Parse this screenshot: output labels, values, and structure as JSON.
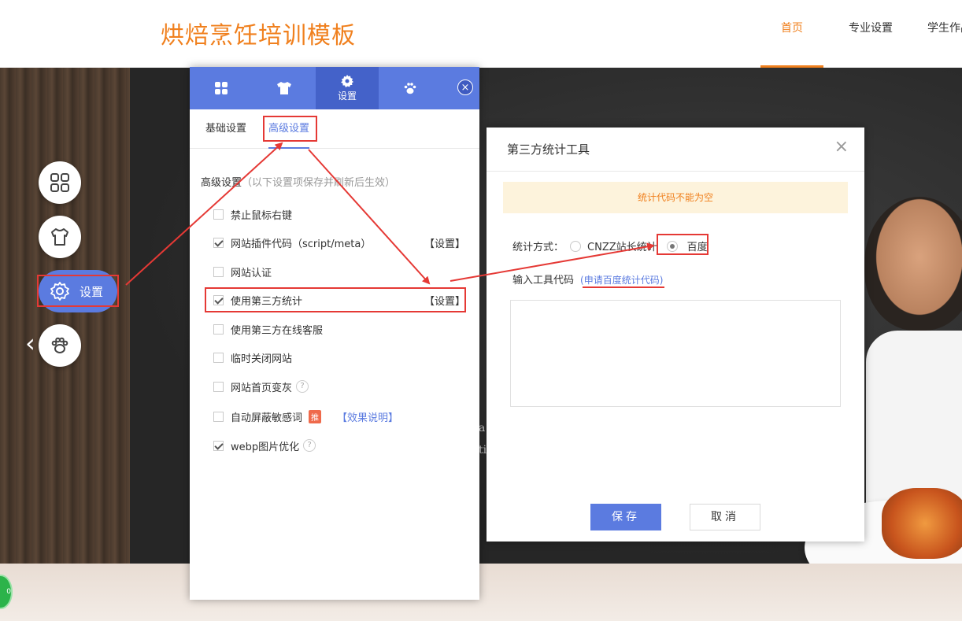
{
  "header": {
    "site_title": "烘焙烹饪培训模板",
    "nav": [
      "首页",
      "专业设置",
      "学生作品"
    ]
  },
  "float_tools": {
    "settings_label": "设置"
  },
  "panel": {
    "tabs": [
      {
        "icon": "grid-icon",
        "label": ""
      },
      {
        "icon": "tshirt-icon",
        "label": ""
      },
      {
        "icon": "gear-icon",
        "label": "设置"
      },
      {
        "icon": "paw-icon",
        "label": ""
      }
    ],
    "close": "×",
    "sub_tabs": [
      "基础设置",
      "高级设置"
    ],
    "section_title": "高级设置",
    "section_hint": "（以下设置项保存并刷新后生效）",
    "options": [
      {
        "label": "禁止鼠标右键",
        "checked": false
      },
      {
        "label": "网站插件代码（script/meta）",
        "checked": true,
        "action": "【设置】"
      },
      {
        "label": "网站认证",
        "checked": false
      },
      {
        "label": "使用第三方统计",
        "checked": true,
        "action": "【设置】"
      },
      {
        "label": "使用第三方在线客服",
        "checked": false
      },
      {
        "label": "临时关闭网站",
        "checked": false
      },
      {
        "label": "网站首页变灰",
        "checked": false,
        "help": "?"
      },
      {
        "label": "自动屏蔽敏感词",
        "checked": false,
        "badge": "推",
        "link": "【效果说明】"
      },
      {
        "label": "webp图片优化",
        "checked": true,
        "help": "?"
      }
    ]
  },
  "modal": {
    "title": "第三方统计工具",
    "close": "×",
    "alert": "统计代码不能为空",
    "method_label": "统计方式：",
    "method_options": [
      {
        "label": "CNZZ站长统计",
        "selected": false
      },
      {
        "label": "百度",
        "selected": true
      }
    ],
    "code_label": "输入工具代码",
    "code_link": "(申请百度统计代码)",
    "code_value": "",
    "save": "保存",
    "cancel": "取消"
  },
  "colors": {
    "accent": "#5b7be0",
    "brand_orange": "#f0801e",
    "annotation_red": "#e53935"
  }
}
